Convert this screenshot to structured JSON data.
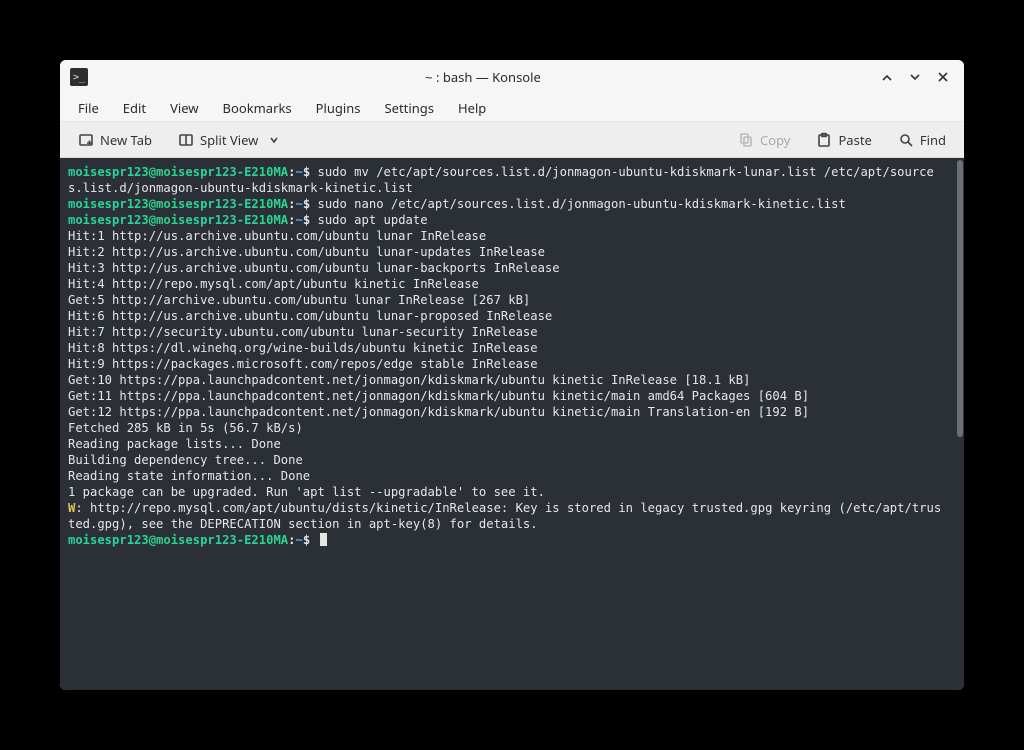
{
  "window": {
    "title": "~ : bash — Konsole",
    "app_icon_text": ">_"
  },
  "menubar": [
    "File",
    "Edit",
    "View",
    "Bookmarks",
    "Plugins",
    "Settings",
    "Help"
  ],
  "toolbar": {
    "new_tab": "New Tab",
    "split_view": "Split View",
    "copy": "Copy",
    "paste": "Paste",
    "find": "Find"
  },
  "prompt": {
    "user_host": "moisespr123@moisespr123-E210MA",
    "sep": ":",
    "path": "~",
    "dollar": "$"
  },
  "commands": {
    "cmd1": "sudo mv /etc/apt/sources.list.d/jonmagon-ubuntu-kdiskmark-lunar.list /etc/apt/sources.list.d/jonmagon-ubuntu-kdiskmark-kinetic.list",
    "cmd2": "sudo nano /etc/apt/sources.list.d/jonmagon-ubuntu-kdiskmark-kinetic.list",
    "cmd3": "sudo apt update"
  },
  "apt_output": [
    "Hit:1 http://us.archive.ubuntu.com/ubuntu lunar InRelease",
    "Hit:2 http://us.archive.ubuntu.com/ubuntu lunar-updates InRelease",
    "Hit:3 http://us.archive.ubuntu.com/ubuntu lunar-backports InRelease",
    "Hit:4 http://repo.mysql.com/apt/ubuntu kinetic InRelease",
    "Get:5 http://archive.ubuntu.com/ubuntu lunar InRelease [267 kB]",
    "Hit:6 http://us.archive.ubuntu.com/ubuntu lunar-proposed InRelease",
    "Hit:7 http://security.ubuntu.com/ubuntu lunar-security InRelease",
    "Hit:8 https://dl.winehq.org/wine-builds/ubuntu kinetic InRelease",
    "Hit:9 https://packages.microsoft.com/repos/edge stable InRelease",
    "Get:10 https://ppa.launchpadcontent.net/jonmagon/kdiskmark/ubuntu kinetic InRelease [18.1 kB]",
    "Get:11 https://ppa.launchpadcontent.net/jonmagon/kdiskmark/ubuntu kinetic/main amd64 Packages [604 B]",
    "Get:12 https://ppa.launchpadcontent.net/jonmagon/kdiskmark/ubuntu kinetic/main Translation-en [192 B]",
    "Fetched 285 kB in 5s (56.7 kB/s)",
    "Reading package lists... Done",
    "Building dependency tree... Done",
    "Reading state information... Done",
    "1 package can be upgraded. Run 'apt list --upgradable' to see it."
  ],
  "warning": {
    "tag": "W",
    "text": ": http://repo.mysql.com/apt/ubuntu/dists/kinetic/InRelease: Key is stored in legacy trusted.gpg keyring (/etc/apt/trusted.gpg), see the DEPRECATION section in apt-key(8) for details."
  }
}
